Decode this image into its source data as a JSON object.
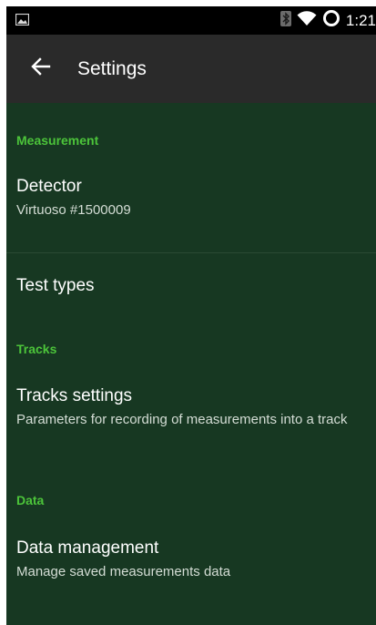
{
  "status_bar": {
    "time": "1:21",
    "icons": [
      "image-notification-icon",
      "bluetooth-icon",
      "wifi-icon",
      "battery-ring-icon"
    ]
  },
  "app_bar": {
    "title": "Settings",
    "back_icon": "arrow-left-icon"
  },
  "colors": {
    "background": "#173822",
    "app_bar": "#2a2a2a",
    "status_bar": "#000000",
    "category_text": "#4cc43a",
    "title_text": "#ffffff",
    "summary_text": "#d4ddd5"
  },
  "sections": [
    {
      "category": "Measurement",
      "items": [
        {
          "title": "Detector",
          "summary": "Virtuoso #1500009"
        },
        {
          "title": "Test types",
          "summary": ""
        }
      ]
    },
    {
      "category": "Tracks",
      "items": [
        {
          "title": "Tracks settings",
          "summary": "Parameters for recording of measurements into a track"
        }
      ]
    },
    {
      "category": "Data",
      "items": [
        {
          "title": "Data management",
          "summary": "Manage saved measurements data"
        }
      ]
    }
  ]
}
